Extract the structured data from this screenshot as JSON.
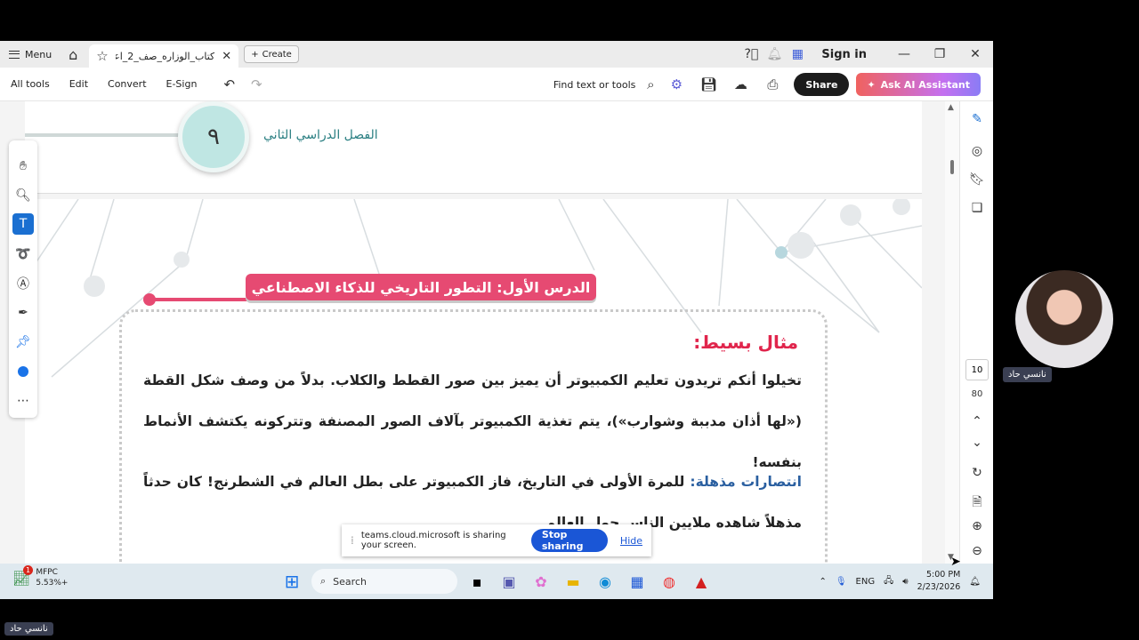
{
  "titlebar": {
    "menu_label": "Menu",
    "tab_title": "كتاب_الوزاره_صف_2_اعدا..",
    "create_label": "Create",
    "signin_label": "Sign in"
  },
  "toolbar": {
    "all_tools": "All tools",
    "edit": "Edit",
    "convert": "Convert",
    "esign": "E-Sign",
    "find_label": "Find text or tools",
    "share_label": "Share",
    "ai_label": "Ask AI Assistant"
  },
  "page": {
    "chapter_number": "٩",
    "semester": "الفصل الدراسي الثاني",
    "lesson_title": "الدرس الأول: التطور التاريخي للذكاء الاصطناعي",
    "example_title": "مثال بسيط:",
    "paragraph1": "تخيلوا أنكم تريدون تعليم الكمبيوتر أن يميز بين صور القطط والكلاب. بدلاً من وصف شكل القطة («لها أذان مدببة وشوارب»)، يتم تغذية الكمبيوتر بآلاف الصور المصنفة وتتركونه يكتشف الأنماط بنفسه!",
    "paragraph2_highlight": "انتصارات مذهلة:",
    "paragraph2": " للمرة الأولى في التاريخ، فاز الكمبيوتر على بطل العالم في الشطرنج! كان حدثاً مذهلاً شاهده ملايين الناس حول العالم"
  },
  "navigation": {
    "current_page": "10",
    "total_pages": "80"
  },
  "sharing_bar": {
    "message": "teams.cloud.microsoft is sharing your screen.",
    "stop_label": "Stop sharing",
    "hide_label": "Hide"
  },
  "taskbar": {
    "stock_name": "MFPC",
    "stock_value": "5.53%+",
    "stock_badge": "1",
    "search_placeholder": "Search",
    "language": "ENG",
    "time": "5:00 PM",
    "date": "2/23/2026"
  },
  "participant": {
    "name": "نانسي حاد"
  },
  "colors": {
    "accent_red": "#e64a72",
    "teams_blue": "#1a56d6",
    "toolbar_active": "#1a6fd1"
  }
}
